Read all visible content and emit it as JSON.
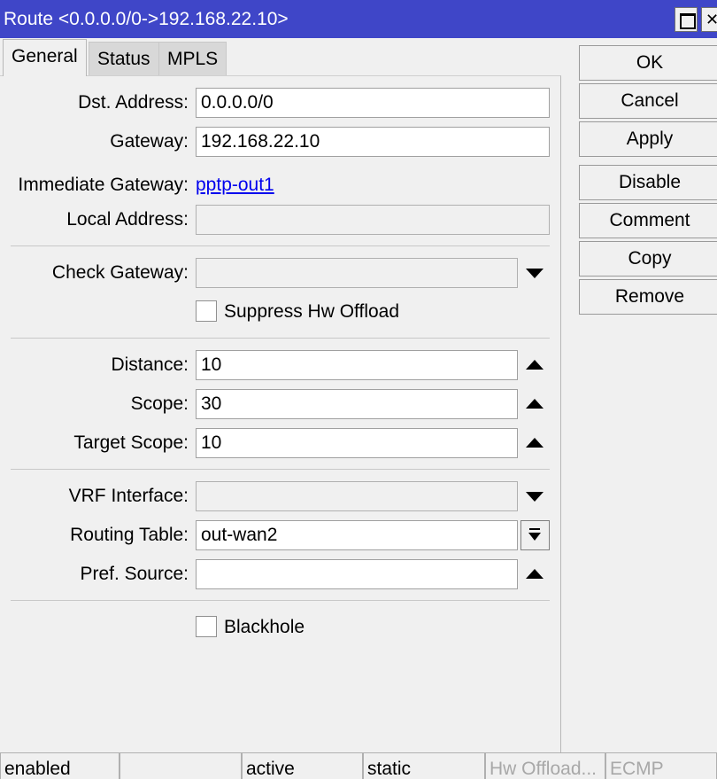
{
  "window": {
    "title": "Route <0.0.0.0/0->192.168.22.10>",
    "maximize_icon": "maximize-icon",
    "close_icon": "close-icon",
    "close_glyph": "✕"
  },
  "tabs": [
    {
      "label": "General",
      "active": true
    },
    {
      "label": "Status",
      "active": false
    },
    {
      "label": "MPLS",
      "active": false
    }
  ],
  "form": {
    "dst_address": {
      "label": "Dst. Address:",
      "value": "0.0.0.0/0"
    },
    "gateway": {
      "label": "Gateway:",
      "value": "192.168.22.10"
    },
    "immediate_gateway": {
      "label": "Immediate Gateway:",
      "value": "pptp-out1"
    },
    "local_address": {
      "label": "Local Address:",
      "value": ""
    },
    "check_gateway": {
      "label": "Check Gateway:",
      "value": "",
      "icon": "dropdown-arrow-icon"
    },
    "suppress_hw_offload": {
      "label": "Suppress Hw Offload",
      "checked": false
    },
    "distance": {
      "label": "Distance:",
      "value": "10",
      "icon": "collapse-arrow-icon"
    },
    "scope": {
      "label": "Scope:",
      "value": "30",
      "icon": "collapse-arrow-icon"
    },
    "target_scope": {
      "label": "Target Scope:",
      "value": "10",
      "icon": "collapse-arrow-icon"
    },
    "vrf_interface": {
      "label": "VRF Interface:",
      "value": "",
      "icon": "dropdown-arrow-icon"
    },
    "routing_table": {
      "label": "Routing Table:",
      "value": "out-wan2",
      "icon": "select-dropdown-icon"
    },
    "pref_source": {
      "label": "Pref. Source:",
      "value": "",
      "icon": "collapse-arrow-icon"
    },
    "blackhole": {
      "label": "Blackhole",
      "checked": false
    }
  },
  "buttons": {
    "ok": "OK",
    "cancel": "Cancel",
    "apply": "Apply",
    "disable": "Disable",
    "comment": "Comment",
    "copy": "Copy",
    "remove": "Remove"
  },
  "status_bar": {
    "state": "enabled",
    "blank": "",
    "active": "active",
    "type": "static",
    "hw_offload": "Hw Offload...",
    "ecmp": "ECMP"
  },
  "colors": {
    "titlebar": "#3f46c8",
    "link": "#0000ee",
    "background": "#f0f0f0",
    "disabled_text": "#a8a8a8"
  }
}
